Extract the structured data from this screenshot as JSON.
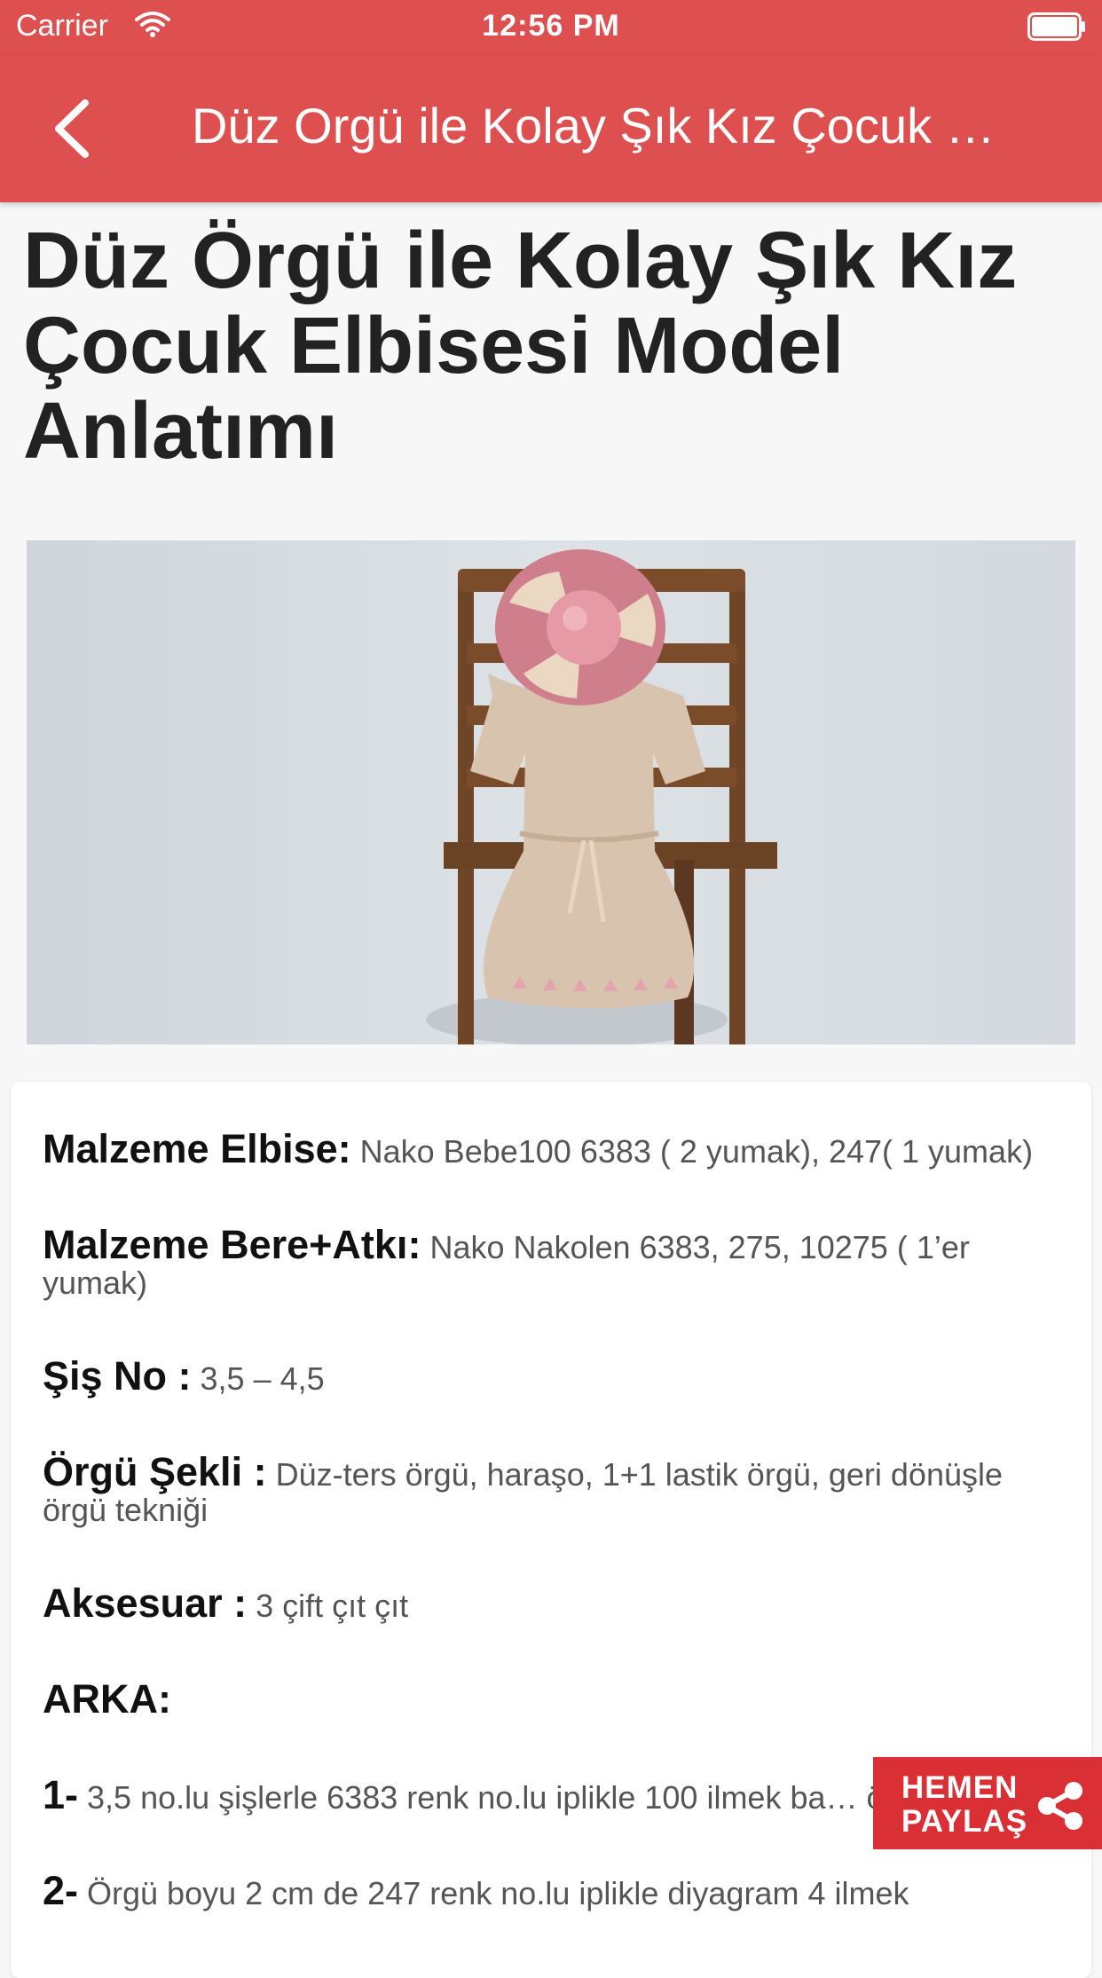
{
  "status_bar": {
    "carrier": "Carrier",
    "time": "12:56 PM"
  },
  "nav": {
    "title": "Düz Orgü ile Kolay Şık Kız Çocuk …"
  },
  "article": {
    "title": "Düz Örgü ile Kolay Şık Kız Çocuk Elbisesi Model Anlatımı",
    "paragraphs": [
      {
        "label": "Malzeme Elbise:",
        "text": " Nako Bebe100 6383 ( 2 yumak), 247( 1 yumak)"
      },
      {
        "label": "Malzeme Bere+Atkı:",
        "text": " Nako Nakolen 6383, 275, 10275 ( 1’er yumak)"
      },
      {
        "label": "Şiş No :",
        "text": " 3,5 – 4,5"
      },
      {
        "label": "Örgü Şekli :",
        "text": " Düz-ters örgü, haraşo, 1+1 lastik örgü, geri dönüşle örgü tekniği"
      },
      {
        "label": "Aksesuar :",
        "text": " 3 çift çıt çıt"
      },
      {
        "label": "ARKA:",
        "text": ""
      },
      {
        "label": "1-",
        "text": " 3,5 no.lu şişlerle 6383 renk no.lu iplikle 100 ilmek ba… örülür."
      },
      {
        "label": "2-",
        "text": " Örgü boyu 2 cm de 247 renk no.lu iplikle diyagram 4 ilmek"
      }
    ]
  },
  "share_button": {
    "line1": "HEMEN",
    "line2": "PAYLAŞ"
  },
  "colors": {
    "accent": "#de5050",
    "share": "#d92f35"
  }
}
